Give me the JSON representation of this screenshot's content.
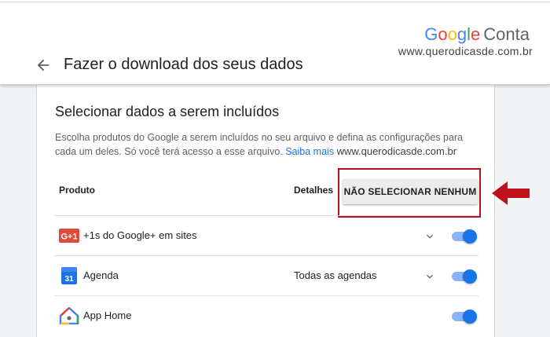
{
  "header": {
    "brand_google": [
      "G",
      "o",
      "o",
      "g",
      "l",
      "e"
    ],
    "brand_suffix": "Conta",
    "watermark": "www.querodicasde.com.br",
    "title": "Fazer o download dos seus dados",
    "back_icon": "arrow-back-icon"
  },
  "section": {
    "title": "Selecionar dados a serem incluídos",
    "description_line1": "Escolha produtos do Google a serem incluídos no seu arquivo e defina as configurações para",
    "description_line2": "cada um deles. Só você terá acesso a esse arquivo.",
    "learn_more": "Saiba mais",
    "watermark": "www.querodicasde.com.br"
  },
  "table": {
    "col_product": "Produto",
    "col_details": "Detalhes",
    "deselect_all_button": "NÃO SELECIONAR NENHUM",
    "rows": [
      {
        "label": "+1s do Google+ em sites",
        "icon": "google-plus-icon",
        "icon_text": "G+1",
        "detail": "",
        "expandable": true,
        "enabled": true
      },
      {
        "label": "Agenda",
        "icon": "calendar-icon",
        "icon_text": "31",
        "detail": "Todas as agendas",
        "expandable": true,
        "enabled": true
      },
      {
        "label": "App Home",
        "icon": "google-home-icon",
        "detail": "",
        "expandable": false,
        "enabled": true
      }
    ]
  },
  "colors": {
    "accent": "#1a73e8",
    "toggle_track": "#8ab4f8",
    "highlight": "#b0141c",
    "google_plus": "#dd4b39"
  }
}
